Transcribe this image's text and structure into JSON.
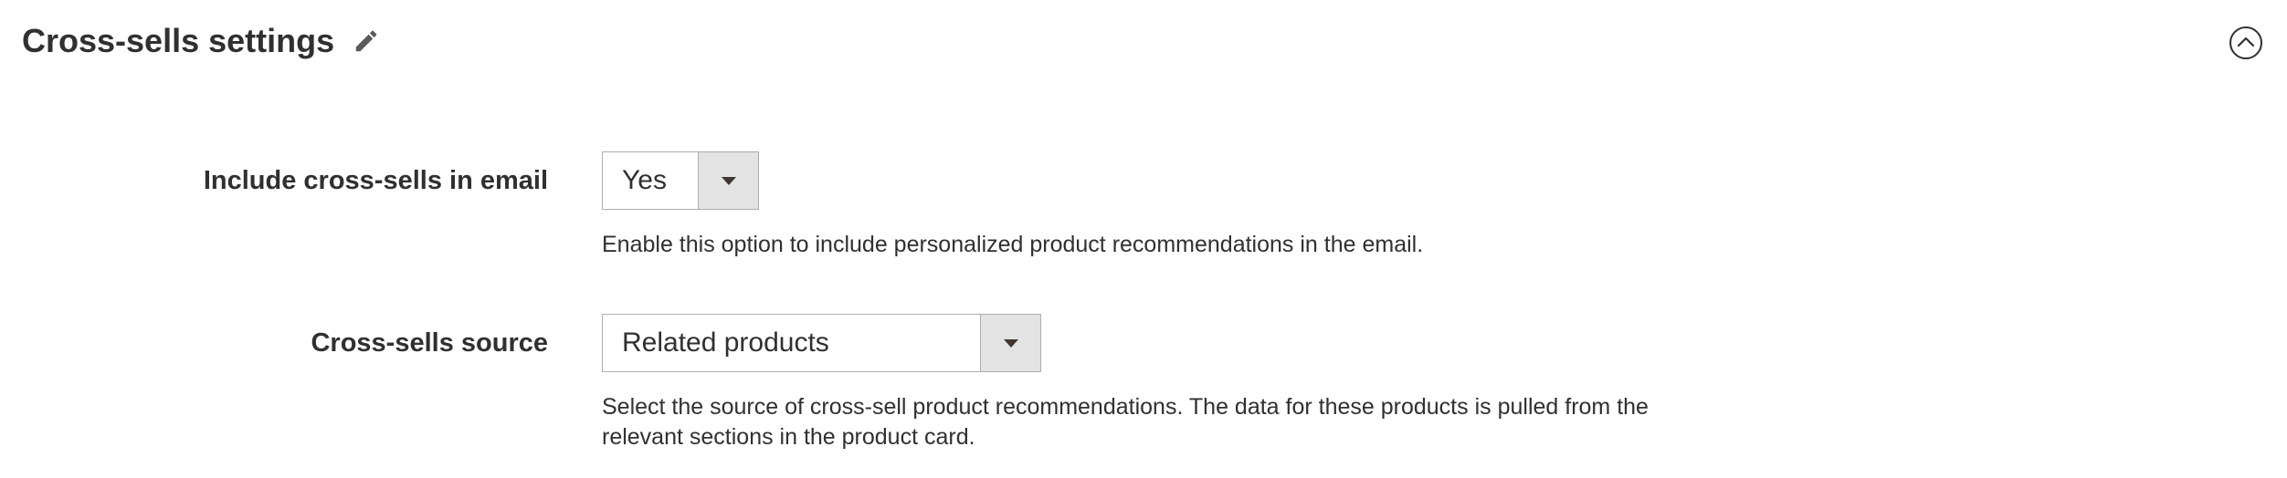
{
  "section": {
    "title": "Cross-sells settings",
    "edit_icon": "pencil-icon",
    "collapse_icon": "chevron-up-circle-icon"
  },
  "fields": [
    {
      "label": "Include cross-sells in email",
      "value": "Yes",
      "note": "Enable this option to include personalized product recommendations in the email."
    },
    {
      "label": "Cross-sells source",
      "value": "Related products",
      "note": "Select the source of cross-sell product recommendations. The data for these products is pulled from the relevant sections in the product card."
    }
  ],
  "colors": {
    "text": "#303030",
    "border": "#adadad",
    "arrow_bg": "#e3e3e3"
  }
}
